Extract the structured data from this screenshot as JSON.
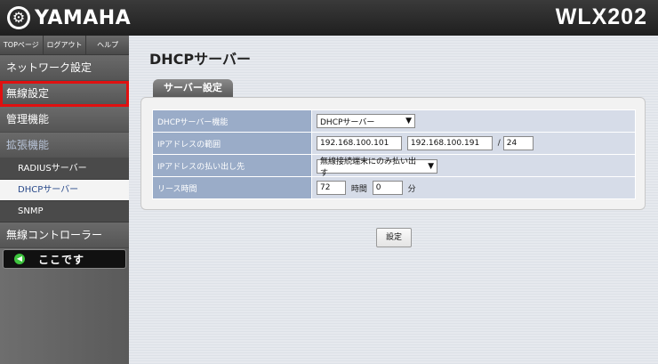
{
  "header": {
    "brand": "YAMAHA",
    "model": "WLX202"
  },
  "sidebar": {
    "top_buttons": [
      "TOPページ",
      "ログアウト",
      "ヘルプ"
    ],
    "menu": [
      {
        "label": "ネットワーク設定"
      },
      {
        "label": "無線設定"
      },
      {
        "label": "管理機能"
      },
      {
        "label": "拡張機能"
      }
    ],
    "submenu": [
      "RADIUSサーバー",
      "DHCPサーバー",
      "SNMP"
    ],
    "menu_after": {
      "label": "無線コントローラー"
    },
    "here": {
      "label": "ここです",
      "icon": "arrow-icon"
    }
  },
  "main": {
    "title": "DHCPサーバー",
    "section_tab": "サーバー設定",
    "rows": {
      "dhcp_function": {
        "label": "DHCPサーバー機能",
        "value": "DHCPサーバー"
      },
      "ip_range": {
        "label": "IPアドレスの範囲",
        "start": "192.168.100.101",
        "end": "192.168.100.191",
        "separator": "/",
        "prefix": "24"
      },
      "ip_target": {
        "label": "IPアドレスの払い出し先",
        "value": "無線接続端末にのみ払い出す"
      },
      "lease": {
        "label": "リース時間",
        "hours": "72",
        "hours_unit": "時間",
        "minutes": "0",
        "minutes_unit": "分"
      }
    },
    "submit_label": "設定"
  },
  "colors": {
    "highlight": "#e01010",
    "table_label_bg": "#9aacc8",
    "table_value_bg": "#d6dce8",
    "here_icon": "#3ec43e"
  }
}
